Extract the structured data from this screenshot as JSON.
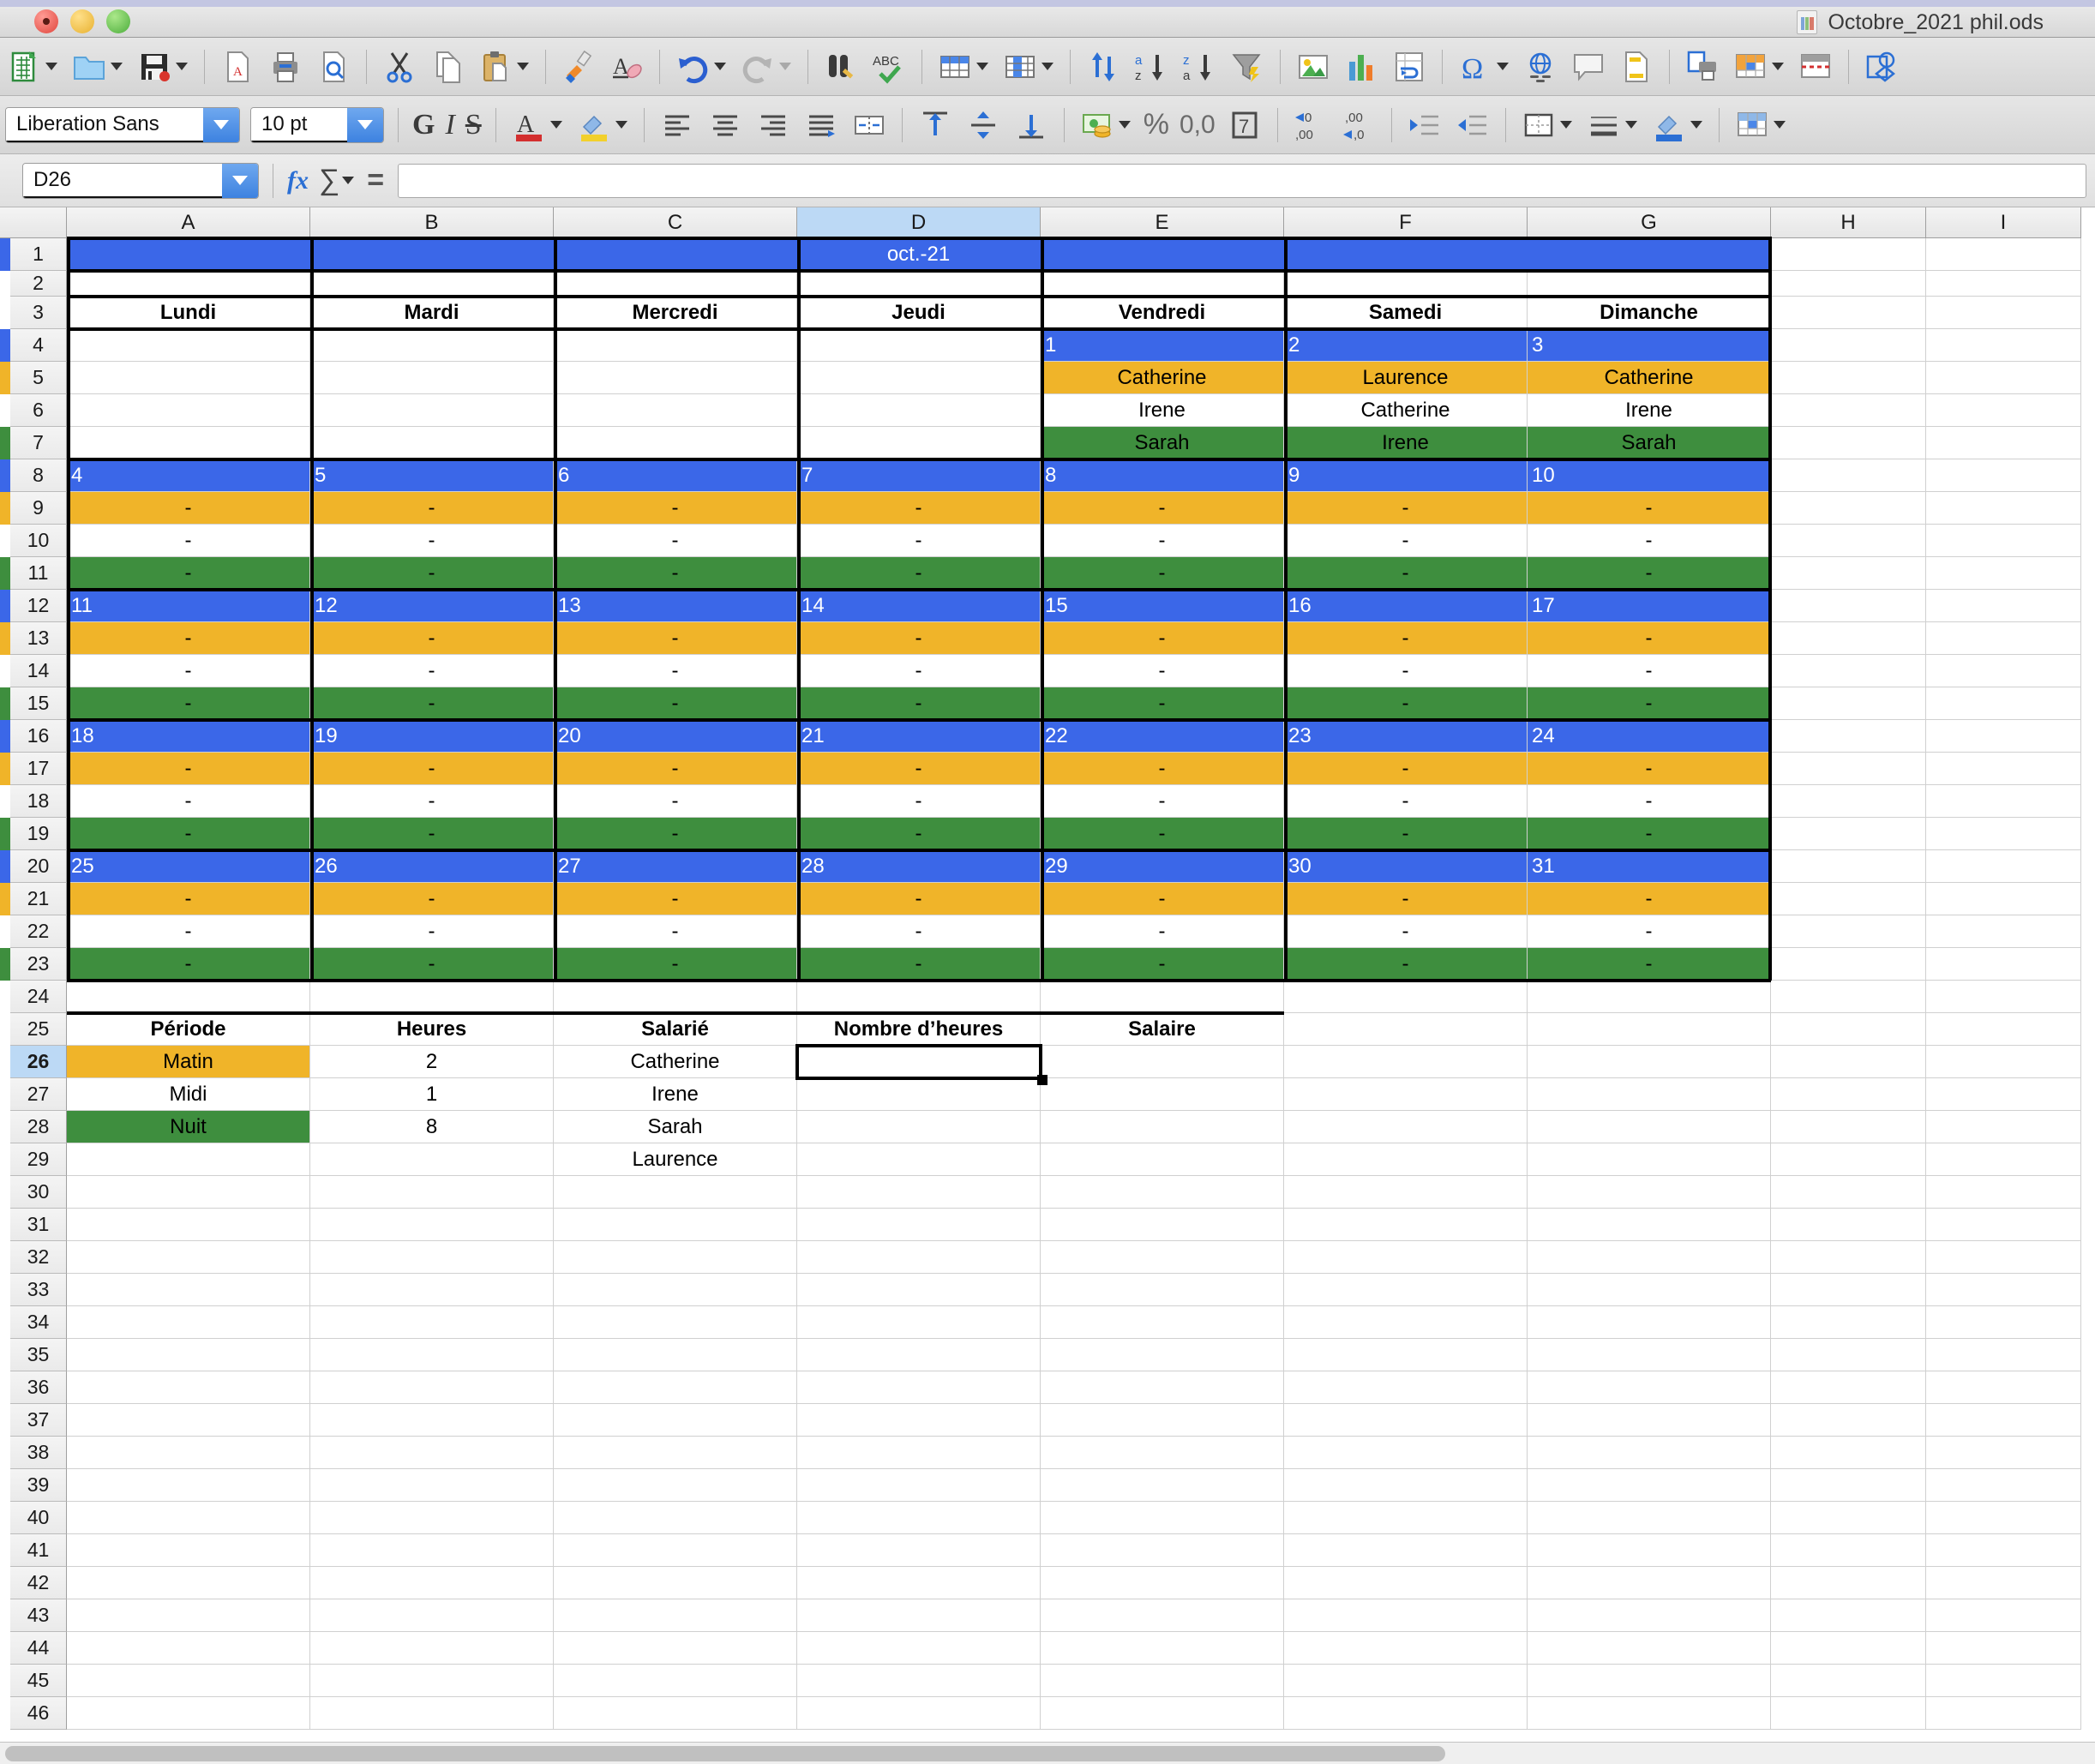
{
  "window": {
    "title": "Octobre_2021 phil.ods",
    "doc_icon": "calc-document-icon",
    "controls": [
      "close-button",
      "minimize-button",
      "zoom-button"
    ]
  },
  "toolbar_standard": {
    "items": [
      {
        "name": "new-document",
        "label": "New"
      },
      {
        "name": "open-document",
        "label": "Open"
      },
      {
        "name": "save-document",
        "label": "Save"
      },
      {
        "name": "export-pdf",
        "label": "Export as PDF"
      },
      {
        "name": "print",
        "label": "Print"
      },
      {
        "name": "print-preview",
        "label": "Toggle Print Preview"
      },
      {
        "name": "cut",
        "label": "Cut"
      },
      {
        "name": "copy",
        "label": "Copy"
      },
      {
        "name": "paste",
        "label": "Paste"
      },
      {
        "name": "clone-formatting",
        "label": "Clone Formatting"
      },
      {
        "name": "clear-formatting",
        "label": "Clear Formatting"
      },
      {
        "name": "undo",
        "label": "Undo"
      },
      {
        "name": "redo",
        "label": "Redo"
      },
      {
        "name": "find-and-replace",
        "label": "Find and Replace"
      },
      {
        "name": "spelling",
        "label": "Spelling"
      },
      {
        "name": "row",
        "label": "Row"
      },
      {
        "name": "column",
        "label": "Column"
      },
      {
        "name": "sort",
        "label": "Sort"
      },
      {
        "name": "sort-ascending",
        "label": "Sort Ascending"
      },
      {
        "name": "sort-descending",
        "label": "Sort Descending"
      },
      {
        "name": "autofilter",
        "label": "AutoFilter"
      },
      {
        "name": "insert-image",
        "label": "Insert Image"
      },
      {
        "name": "insert-chart",
        "label": "Insert Chart"
      },
      {
        "name": "pivot-table",
        "label": "Pivot Table"
      },
      {
        "name": "special-character",
        "label": "Special Character"
      },
      {
        "name": "hyperlink",
        "label": "Insert Hyperlink"
      },
      {
        "name": "comment",
        "label": "Insert Comment"
      },
      {
        "name": "headers-and-footers",
        "label": "Headers and Footers"
      },
      {
        "name": "define-print-area",
        "label": "Define Print Area"
      },
      {
        "name": "conditional-formatting",
        "label": "Conditional Formatting"
      },
      {
        "name": "freeze-rows-columns",
        "label": "Freeze Rows and Columns"
      },
      {
        "name": "show-draw-functions",
        "label": "Show Draw Functions"
      }
    ]
  },
  "toolbar_formatting": {
    "font_name": "Liberation Sans",
    "font_size": "10 pt",
    "bold_label": "G",
    "italic_label": "I",
    "strikethrough_label": "S",
    "percent_label": "%",
    "number_label": "0,0",
    "date_label": "7",
    "items": [
      {
        "name": "font-color",
        "label": "Font Color"
      },
      {
        "name": "background-color",
        "label": "Background Color"
      },
      {
        "name": "align-left",
        "label": "Align Left"
      },
      {
        "name": "align-center",
        "label": "Align Center"
      },
      {
        "name": "align-right",
        "label": "Align Right"
      },
      {
        "name": "justified",
        "label": "Justified"
      },
      {
        "name": "merge-cells",
        "label": "Merge Cells"
      },
      {
        "name": "align-top",
        "label": "Align Top"
      },
      {
        "name": "center-vertically",
        "label": "Center Vertically"
      },
      {
        "name": "align-bottom",
        "label": "Align Bottom"
      },
      {
        "name": "format-as-currency",
        "label": "Format as Currency"
      },
      {
        "name": "format-as-percent",
        "label": "Format as Percent"
      },
      {
        "name": "format-as-number",
        "label": "Format as Number"
      },
      {
        "name": "format-as-date",
        "label": "Format as Date"
      },
      {
        "name": "add-decimal-place",
        "label": "Add Decimal Place"
      },
      {
        "name": "delete-decimal-place",
        "label": "Delete Decimal Place"
      },
      {
        "name": "increase-indent",
        "label": "Increase Indent"
      },
      {
        "name": "decrease-indent",
        "label": "Decrease Indent"
      },
      {
        "name": "borders",
        "label": "Borders"
      },
      {
        "name": "border-style",
        "label": "Border Style"
      },
      {
        "name": "border-color",
        "label": "Border Color"
      },
      {
        "name": "conditional",
        "label": "Conditional"
      }
    ]
  },
  "formula_bar": {
    "cell_reference": "D26",
    "function_wizard_label": "fx",
    "sum_label": "∑",
    "formula_label": "=",
    "input_value": "",
    "input_placeholder": ""
  },
  "grid": {
    "columns": [
      "A",
      "B",
      "C",
      "D",
      "E",
      "F",
      "G",
      "H",
      "I"
    ],
    "selected_column": "D",
    "selected_row": 26,
    "selected_cell": "D26",
    "rows": [
      1,
      2,
      3,
      4,
      5,
      6,
      7,
      8,
      9,
      10,
      11,
      12,
      13,
      14,
      15,
      16,
      17,
      18,
      19,
      20,
      21,
      22,
      23,
      24,
      25,
      26,
      27,
      28,
      29,
      30,
      31,
      32,
      33,
      34,
      35,
      36,
      37,
      38,
      39,
      40,
      41,
      42,
      43,
      44,
      45,
      46
    ]
  },
  "colors": {
    "blue": "#3b67e8",
    "amber": "#f0b429",
    "green": "#3e8e3e",
    "header_selected": "#bcd9f5",
    "white": "#ffffff"
  },
  "calendar": {
    "month_title": "oct.-21",
    "day_headers": [
      "Lundi",
      "Mardi",
      "Mercredi",
      "Jeudi",
      "Vendredi",
      "Samedi",
      "Dimanche"
    ],
    "weeks": [
      {
        "days": [
          {
            "date": "",
            "shifts": [
              "",
              "",
              ""
            ],
            "empty": true
          },
          {
            "date": "",
            "shifts": [
              "",
              "",
              ""
            ],
            "empty": true
          },
          {
            "date": "",
            "shifts": [
              "",
              "",
              ""
            ],
            "empty": true
          },
          {
            "date": "",
            "shifts": [
              "",
              "",
              ""
            ],
            "empty": true
          },
          {
            "date": "1",
            "shifts": [
              "Catherine",
              "Irene",
              "Sarah"
            ]
          },
          {
            "date": "2",
            "shifts": [
              "Laurence",
              "Catherine",
              "Irene"
            ]
          },
          {
            "date": "3",
            "shifts": [
              "Catherine",
              "Irene",
              "Sarah"
            ]
          }
        ]
      },
      {
        "days": [
          {
            "date": "4",
            "shifts": [
              "-",
              "-",
              "-"
            ]
          },
          {
            "date": "5",
            "shifts": [
              "-",
              "-",
              "-"
            ]
          },
          {
            "date": "6",
            "shifts": [
              "-",
              "-",
              "-"
            ]
          },
          {
            "date": "7",
            "shifts": [
              "-",
              "-",
              "-"
            ]
          },
          {
            "date": "8",
            "shifts": [
              "-",
              "-",
              "-"
            ]
          },
          {
            "date": "9",
            "shifts": [
              "-",
              "-",
              "-"
            ]
          },
          {
            "date": "10",
            "shifts": [
              "-",
              "-",
              "-"
            ]
          }
        ]
      },
      {
        "days": [
          {
            "date": "11",
            "shifts": [
              "-",
              "-",
              "-"
            ]
          },
          {
            "date": "12",
            "shifts": [
              "-",
              "-",
              "-"
            ]
          },
          {
            "date": "13",
            "shifts": [
              "-",
              "-",
              "-"
            ]
          },
          {
            "date": "14",
            "shifts": [
              "-",
              "-",
              "-"
            ]
          },
          {
            "date": "15",
            "shifts": [
              "-",
              "-",
              "-"
            ]
          },
          {
            "date": "16",
            "shifts": [
              "-",
              "-",
              "-"
            ]
          },
          {
            "date": "17",
            "shifts": [
              "-",
              "-",
              "-"
            ]
          }
        ]
      },
      {
        "days": [
          {
            "date": "18",
            "shifts": [
              "-",
              "-",
              "-"
            ]
          },
          {
            "date": "19",
            "shifts": [
              "-",
              "-",
              "-"
            ]
          },
          {
            "date": "20",
            "shifts": [
              "-",
              "-",
              "-"
            ]
          },
          {
            "date": "21",
            "shifts": [
              "-",
              "-",
              "-"
            ]
          },
          {
            "date": "22",
            "shifts": [
              "-",
              "-",
              "-"
            ]
          },
          {
            "date": "23",
            "shifts": [
              "-",
              "-",
              "-"
            ]
          },
          {
            "date": "24",
            "shifts": [
              "-",
              "-",
              "-"
            ]
          }
        ]
      },
      {
        "days": [
          {
            "date": "25",
            "shifts": [
              "-",
              "-",
              "-"
            ]
          },
          {
            "date": "26",
            "shifts": [
              "-",
              "-",
              "-"
            ]
          },
          {
            "date": "27",
            "shifts": [
              "-",
              "-",
              "-"
            ]
          },
          {
            "date": "28",
            "shifts": [
              "-",
              "-",
              "-"
            ]
          },
          {
            "date": "29",
            "shifts": [
              "-",
              "-",
              "-"
            ]
          },
          {
            "date": "30",
            "shifts": [
              "-",
              "-",
              "-"
            ]
          },
          {
            "date": "31",
            "shifts": [
              "-",
              "-",
              "-"
            ]
          }
        ]
      }
    ]
  },
  "legend": {
    "headers": [
      "Période",
      "Heures",
      "Salarié",
      "Nombre d’heures",
      "Salaire"
    ],
    "rows": [
      {
        "periode": "Matin",
        "heures": "2",
        "salarie": "Catherine",
        "nombre_heures": "",
        "salaire": ""
      },
      {
        "periode": "Midi",
        "heures": "1",
        "salarie": "Irene",
        "nombre_heures": "",
        "salaire": ""
      },
      {
        "periode": "Nuit",
        "heures": "8",
        "salarie": "Sarah",
        "nombre_heures": "",
        "salaire": ""
      },
      {
        "periode": "",
        "heures": "",
        "salarie": "Laurence",
        "nombre_heures": "",
        "salaire": ""
      }
    ]
  }
}
